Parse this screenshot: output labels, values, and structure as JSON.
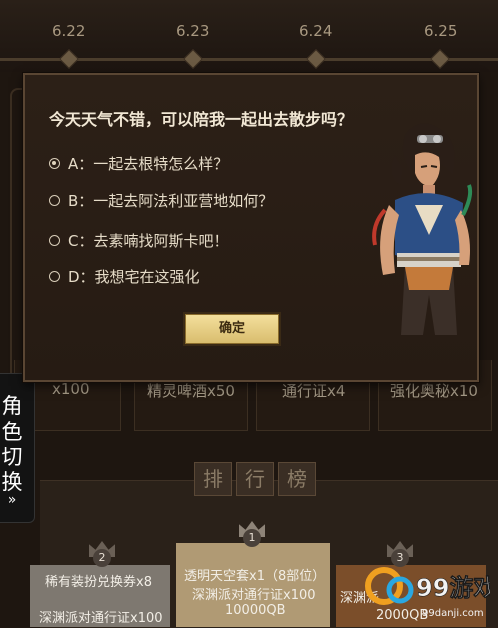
{
  "timeline": {
    "dates": [
      "6.22",
      "6.23",
      "6.24",
      "6.25"
    ]
  },
  "background_rewards": {
    "items": [
      "x100",
      "精灵啤酒x50",
      "通行证x4",
      "强化奥秘x10"
    ]
  },
  "ranking": {
    "title_chars": [
      "排",
      "行",
      "榜"
    ],
    "ranks": [
      {
        "rank": "2",
        "lines": [
          "稀有装扮兑换券x8",
          "深渊派对通行证x100"
        ]
      },
      {
        "rank": "1",
        "lines": [
          "透明天空套x1（8部位）",
          "深渊派对通行证x100",
          "10000QB"
        ]
      },
      {
        "rank": "3",
        "lines": [
          "深渊派",
          "2000QB"
        ]
      }
    ]
  },
  "side_tab": {
    "chars": [
      "角",
      "色",
      "切",
      "换"
    ],
    "arrow": "»"
  },
  "dialog": {
    "question": "今天天气不错，可以陪我一起出去散步吗？",
    "options": [
      {
        "key": "A",
        "text": "A：一起去根特怎么样？",
        "selected": true
      },
      {
        "key": "B",
        "text": "B：一起去阿法利亚营地如何？",
        "selected": false
      },
      {
        "key": "C",
        "text": "C：去素喃找阿斯卡吧！",
        "selected": false
      },
      {
        "key": "D",
        "text": "D：我想宅在这强化",
        "selected": false
      }
    ],
    "confirm_label": "确定"
  },
  "watermark": {
    "logo_text": "99游戏",
    "url": "99danji.com"
  },
  "colors": {
    "dialog_bg": "#2a1e15",
    "confirm_button": "#e8cf84",
    "podium_gold": "#b09a74",
    "podium_silver": "#7e7870",
    "podium_bronze": "#7b4e2a"
  }
}
